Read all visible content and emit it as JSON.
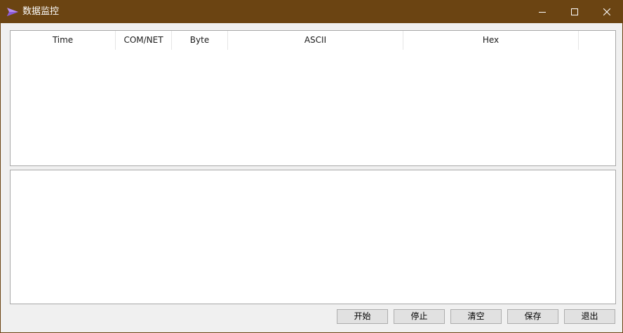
{
  "window": {
    "title": "数据监控",
    "icon": "paper-plane-icon",
    "titlebar_color": "#6b4412"
  },
  "controls": {
    "minimize_icon": "minimize-icon",
    "maximize_icon": "maximize-icon",
    "close_icon": "close-icon"
  },
  "table": {
    "columns": [
      "Time",
      "COM/NET",
      "Byte",
      "ASCII",
      "Hex"
    ],
    "rows": []
  },
  "detail_text": "",
  "buttons": {
    "start": "开始",
    "stop": "停止",
    "clear": "清空",
    "save": "保存",
    "exit": "退出"
  }
}
